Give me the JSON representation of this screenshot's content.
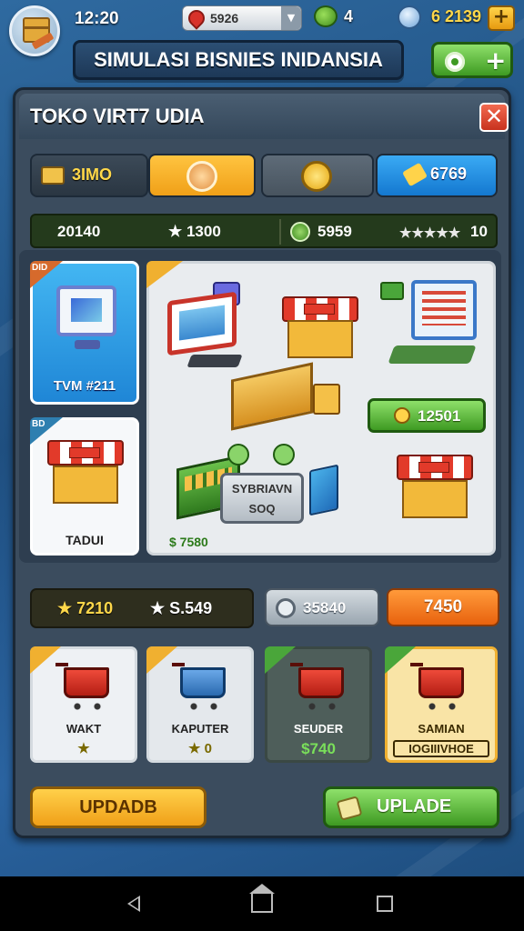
{
  "status": {
    "time": "12:20",
    "location_value": "5926",
    "leaf_count": "4",
    "coins": "6 2139"
  },
  "header": {
    "game_title": "SIMULASI BISNIES INIDANSIA"
  },
  "panel": {
    "title": "TOKO VIRT7 UDIA",
    "tabs": [
      {
        "label": "3IMO",
        "icon": "box-icon"
      },
      {
        "label": "",
        "icon": "sun-coin-icon"
      },
      {
        "label": "",
        "icon": "gold-coin-icon"
      },
      {
        "label": "6769",
        "icon": "pencil-icon"
      }
    ],
    "stats": {
      "left_value": "20140",
      "star_value": "★ 1300",
      "coin_value": "5959",
      "rating_stars": "★★★★★",
      "rating_value": "10"
    },
    "items": {
      "card_tv": {
        "badge": "DID",
        "label": "TVM #211"
      },
      "card_tadu": {
        "badge": "BD",
        "label": "TADUI"
      },
      "big_card": {
        "price_button": "12501",
        "tag_line1": "SYBRIAVN",
        "tag_line2": "SOQ",
        "price": "$ 7580"
      }
    },
    "bottom_stats": {
      "stat_a": "★ 7210",
      "stat_b": "★ S.549",
      "gray_value": "35840",
      "orange_value": "7450"
    },
    "carts": [
      {
        "name": "WAKT",
        "sub": "★"
      },
      {
        "name": "KAPUTER",
        "sub": "★ 0"
      },
      {
        "name": "SEUDER",
        "sub": "$740"
      },
      {
        "name": "SAMIAN",
        "sub": "IOGIIIVHOE"
      }
    ],
    "buttons": {
      "update_left": "UPDADB",
      "update_right": "UPLADE"
    }
  },
  "colors": {
    "accent_orange": "#f0a018",
    "accent_green": "#3e9a22",
    "accent_blue": "#1f86d6",
    "close_red": "#c8321e"
  }
}
